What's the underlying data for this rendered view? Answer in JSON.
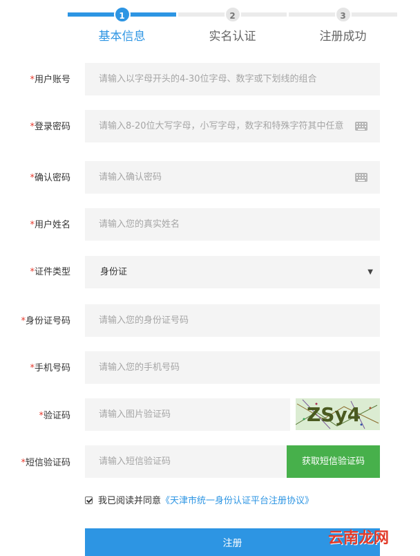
{
  "steps": [
    {
      "num": "1",
      "label": "基本信息"
    },
    {
      "num": "2",
      "label": "实名认证"
    },
    {
      "num": "3",
      "label": "注册成功"
    }
  ],
  "form": {
    "account": {
      "label": "用户账号",
      "placeholder": "请输入以字母开头的4-30位字母、数字或下划线的组合"
    },
    "password": {
      "label": "登录密码",
      "placeholder": "请输入8-20位大写字母，小写字母，数字和特殊字符其中任意"
    },
    "confirm": {
      "label": "确认密码",
      "placeholder": "请输入确认密码"
    },
    "name": {
      "label": "用户姓名",
      "placeholder": "请输入您的真实姓名"
    },
    "id_type": {
      "label": "证件类型",
      "value": "身份证"
    },
    "id_number": {
      "label": "身份证号码",
      "placeholder": "请输入您的身份证号码"
    },
    "phone": {
      "label": "手机号码",
      "placeholder": "请输入您的手机号码"
    },
    "captcha": {
      "label": "验证码",
      "placeholder": "请输入图片验证码",
      "image_text": "ZSy4"
    },
    "sms": {
      "label": "短信验证码",
      "placeholder": "请输入短信验证码",
      "button": "获取短信验证码"
    }
  },
  "required_mark": "*",
  "agreement": {
    "text": "我已阅读并同意",
    "link": "《天津市统一身份认证平台注册协议》"
  },
  "submit_label": "注册",
  "watermark": "云南龙网",
  "colors": {
    "primary": "#2d95e3",
    "success": "#47b04b",
    "required": "#e63b2e"
  }
}
